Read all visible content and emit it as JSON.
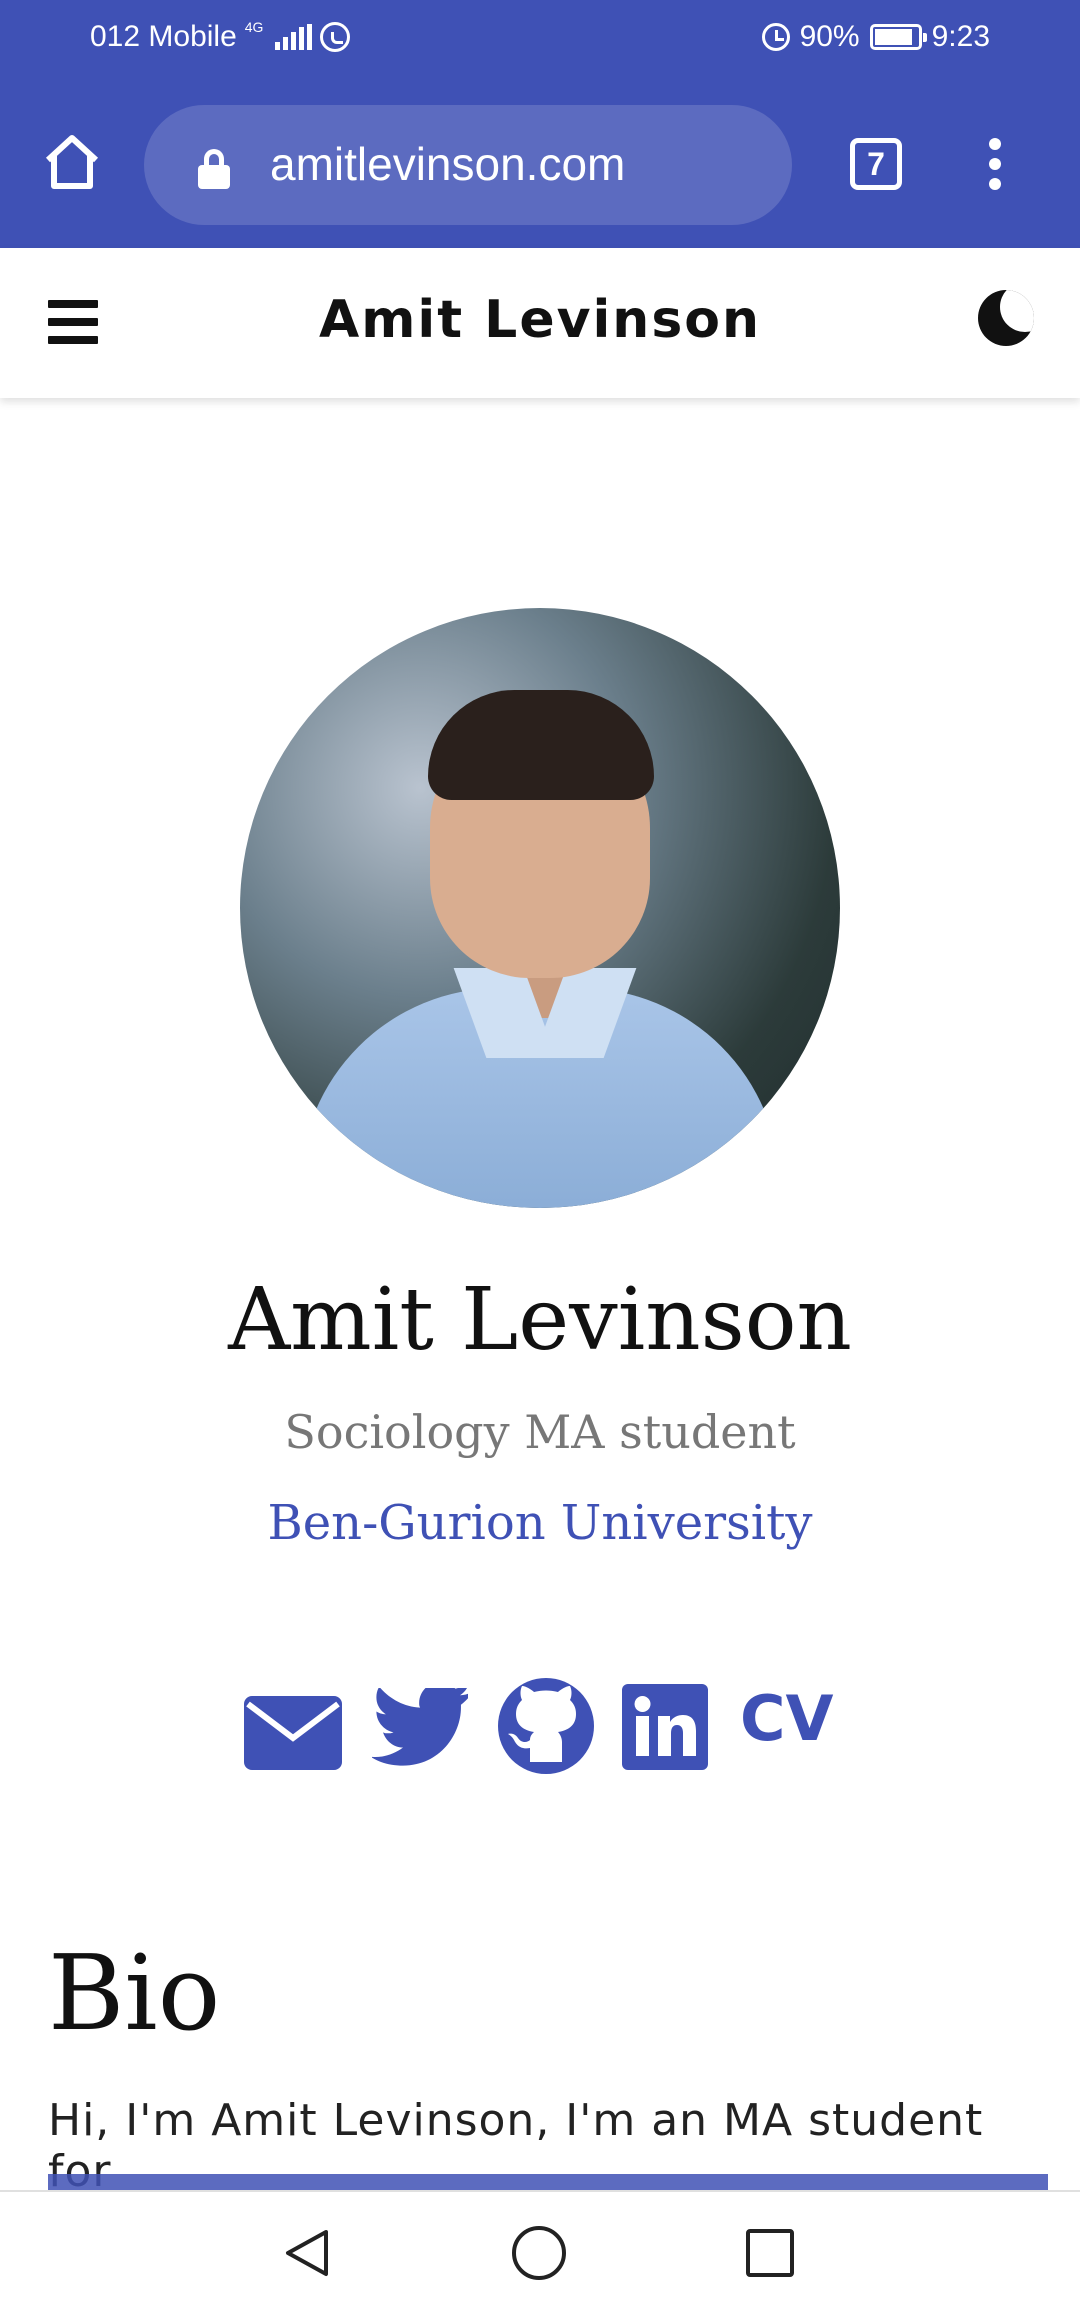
{
  "status_bar": {
    "carrier": "012 Mobile",
    "network_type": "4G",
    "battery_percent": "90%",
    "battery_level": 0.9,
    "time": "9:23"
  },
  "browser": {
    "url": "amitlevinson.com",
    "tab_count": "7"
  },
  "site": {
    "title": "Amit Levinson"
  },
  "profile": {
    "name": "Amit Levinson",
    "role": "Sociology MA student",
    "organization": "Ben-Gurion University"
  },
  "social": {
    "items": [
      "envelope-icon",
      "twitter-icon",
      "github-icon",
      "linkedin-icon"
    ],
    "cv_label": "CV"
  },
  "bio": {
    "heading": "Bio",
    "text": "Hi, I'm Amit Levinson, I'm an MA student for"
  },
  "colors": {
    "primary": "#3f51b5",
    "url_bar": "#5c6bc0"
  }
}
